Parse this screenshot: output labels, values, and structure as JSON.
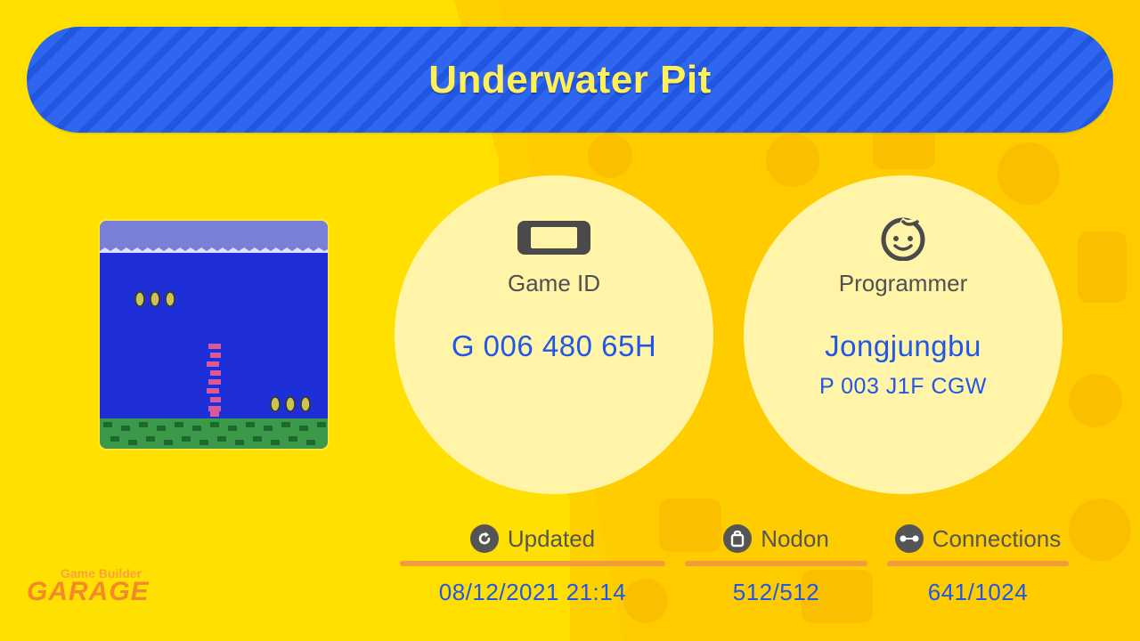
{
  "game": {
    "title": "Underwater Pit"
  },
  "game_id": {
    "label": "Game ID",
    "value": "G 006 480 65H",
    "icon": "handheld-console-icon"
  },
  "programmer": {
    "label": "Programmer",
    "name": "Jongjungbu",
    "id": "P 003 J1F CGW",
    "icon": "face-icon"
  },
  "stats": {
    "updated": {
      "label": "Updated",
      "value": "08/12/2021 21:14",
      "icon": "refresh-icon"
    },
    "nodon": {
      "label": "Nodon",
      "value": "512/512",
      "icon": "bag-icon"
    },
    "connections": {
      "label": "Connections",
      "value": "641/1024",
      "icon": "connection-icon"
    }
  },
  "logo": {
    "line1": "Game Builder",
    "line2": "GARAGE"
  },
  "colors": {
    "background": "#ffe000",
    "banner": "#2e66f0",
    "title_text": "#fff05a",
    "value_text": "#2157e8",
    "accent_bar": "#f29a3c"
  }
}
